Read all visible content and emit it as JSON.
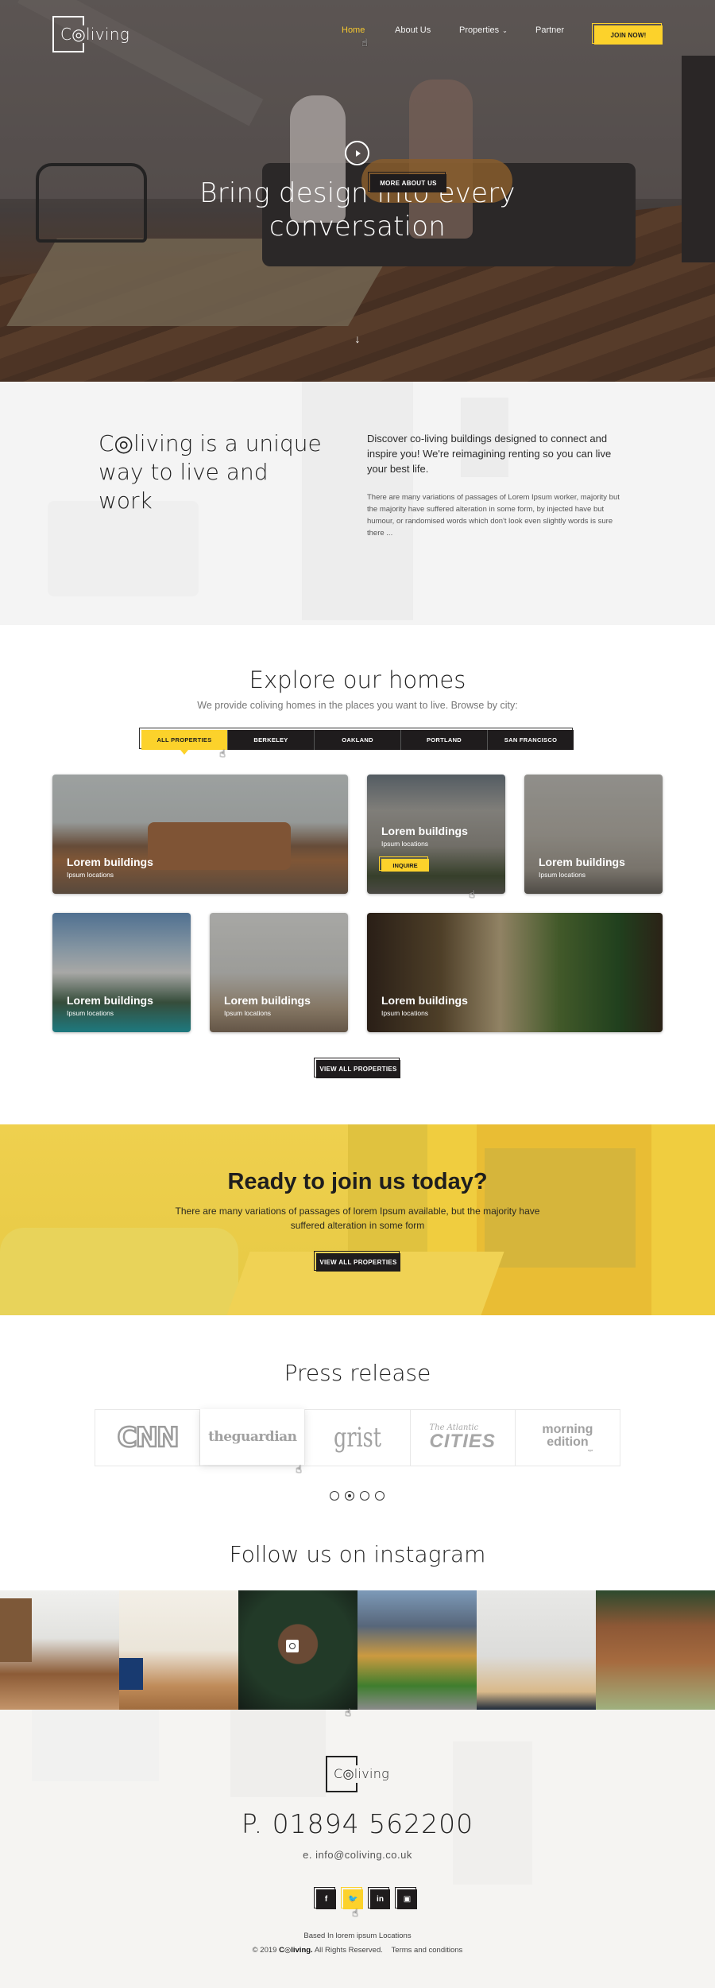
{
  "brand": {
    "name": "Coliving",
    "logo_text": "C◎living",
    "accent": "#fcd22b",
    "dark": "#1f1c1d"
  },
  "header": {
    "nav": [
      {
        "label": "Home",
        "active": true
      },
      {
        "label": "About Us",
        "active": false
      },
      {
        "label": "Properties",
        "active": false,
        "has_dropdown": true
      },
      {
        "label": "Partner",
        "active": false
      }
    ],
    "join_label": "JOIN NOW!"
  },
  "hero": {
    "title": "Bring design into every conversation",
    "play_icon": "play-circle-icon",
    "scroll_icon": "arrow-down-icon"
  },
  "about": {
    "title": "C◎living is a unique way to live and work",
    "lead": "Discover co-living buildings designed to connect and inspire you! We're reimagining renting so you can live your best life.",
    "body": "There are many variations of passages of Lorem Ipsum worker, majority but the majority have suffered alteration in some form, by injected have but humour, or randomised words which don't look even slightly words is sure there ...",
    "button": "MORE ABOUT US"
  },
  "explore": {
    "title": "Explore our homes",
    "subtitle": "We provide coliving homes in the places you want to live. Browse by city:",
    "tabs": [
      {
        "label": "ALL PROPERTIES",
        "active": true
      },
      {
        "label": "BERKELEY",
        "active": false
      },
      {
        "label": "OAKLAND",
        "active": false
      },
      {
        "label": "PORTLAND",
        "active": false
      },
      {
        "label": "SAN FRANCISCO",
        "active": false
      }
    ],
    "properties": [
      {
        "title": "Lorem buildings",
        "location": "Ipsum locations"
      },
      {
        "title": "Lorem buildings",
        "location": "Ipsum locations",
        "cta": "INQUIRE"
      },
      {
        "title": "Lorem buildings",
        "location": "Ipsum locations"
      },
      {
        "title": "Lorem buildings",
        "location": "Ipsum locations"
      },
      {
        "title": "Lorem buildings",
        "location": "Ipsum locations"
      },
      {
        "title": "Lorem buildings",
        "location": "Ipsum locations"
      }
    ],
    "view_all": "VIEW ALL PROPERTIES"
  },
  "cta": {
    "title": "Ready to join us today?",
    "text": "There are many variations of passages of lorem Ipsum available, but the majority have suffered alteration in some form",
    "button": "VIEW ALL PROPERTIES"
  },
  "press": {
    "title": "Press release",
    "logos": [
      {
        "name": "CNN",
        "text": "CNN"
      },
      {
        "name": "The Guardian",
        "text": "theguardian"
      },
      {
        "name": "Grist",
        "text": "grist"
      },
      {
        "name": "The Atlantic Cities",
        "line1": "The Atlantic",
        "line2": "CITIES"
      },
      {
        "name": "Morning Edition",
        "line1": "morning",
        "line2": "edition",
        "line3": "npr"
      }
    ],
    "pages": 4,
    "active_page": 2
  },
  "instagram": {
    "title": "Follow us on instagram",
    "tiles": 6
  },
  "footer": {
    "phone": "P. 01894 562200",
    "email": "e. info@coliving.co.uk",
    "socials": [
      {
        "name": "facebook",
        "glyph": "f",
        "active": false
      },
      {
        "name": "twitter",
        "glyph": "♥",
        "active": true
      },
      {
        "name": "linkedin",
        "glyph": "in",
        "active": false
      },
      {
        "name": "instagram",
        "glyph": "▣",
        "active": false
      }
    ],
    "based": "Based In lorem ipsum Locations",
    "copyright_prefix": "© 2019",
    "copyright_brand": "C◎living.",
    "copyright_suffix": "All Rights Reserved.",
    "terms": "Terms and conditions"
  }
}
